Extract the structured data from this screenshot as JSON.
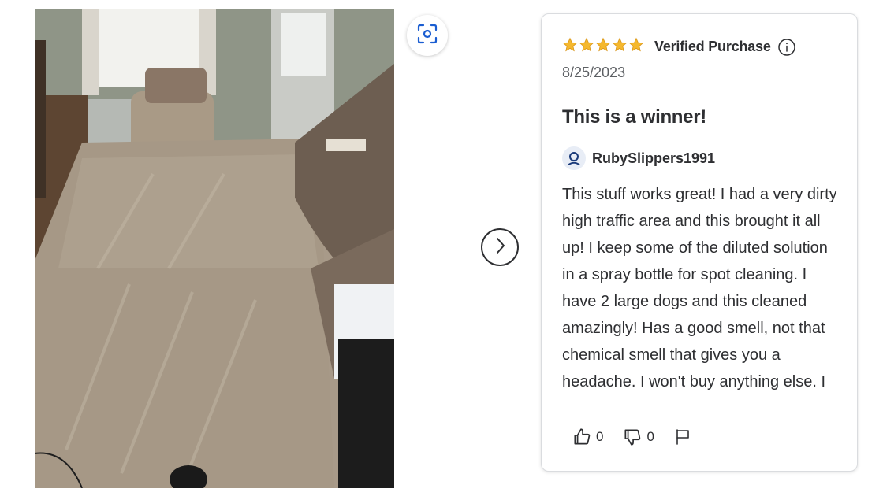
{
  "gallery": {
    "photo_alt": "Customer photo of cleaned carpet in living room",
    "lens_icon": "visual-search-icon",
    "next_icon": "chevron-right-icon"
  },
  "review": {
    "stars": 5,
    "star_color": "#f5b82e",
    "verified_label": "Verified Purchase",
    "date": "8/25/2023",
    "title": "This is a winner!",
    "author": "RubySlippers1991",
    "body": "This stuff works great! I had a very dirty high traffic area and this brought it all up! I keep some of the diluted solution in a spray bottle for spot cleaning. I have 2 large dogs and this cleaned amazingly! Has a good smell, not that chemical smell that gives you a headache. I won't buy anything else. I",
    "helpful_count": "0",
    "not_helpful_count": "0"
  },
  "colors": {
    "text": "#2e2f32",
    "muted": "#5c5f63",
    "avatar_bg": "#e8edf6",
    "avatar_icon": "#1a3a7a"
  }
}
